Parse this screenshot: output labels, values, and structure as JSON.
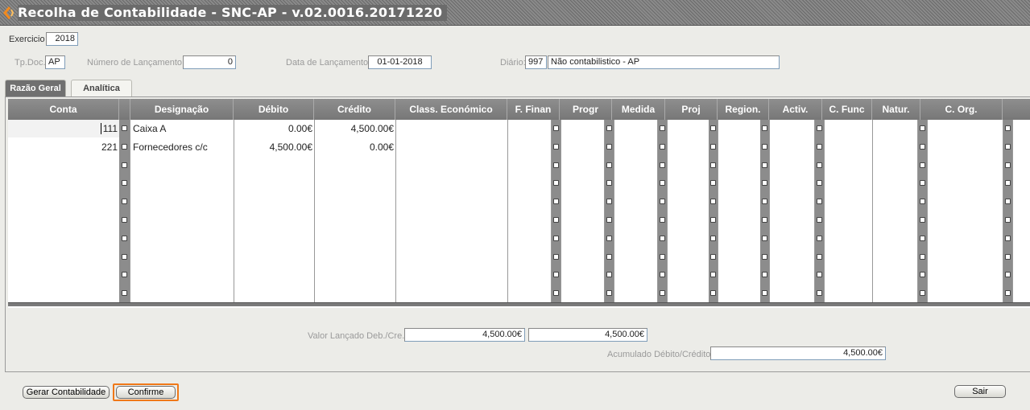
{
  "window": {
    "title": "Recolha de Contabilidade - SNC-AP - v.02.0016.20171220"
  },
  "header": {
    "exercicio_label": "Exercicio",
    "exercicio_value": "2018",
    "tpdoc_label": "Tp.Doc.",
    "tpdoc_value": "AP",
    "numero_label": "Número de Lançamento:",
    "numero_value": "0",
    "data_label": "Data de Lançamento:",
    "data_value": "01-01-2018",
    "diario_label": "Diário:",
    "diario_code": "997",
    "diario_desc": "Não contabilistico - AP"
  },
  "tabs": [
    {
      "label": "Razão Geral",
      "active": true
    },
    {
      "label": "Analítica",
      "active": false
    }
  ],
  "grid": {
    "columns": [
      "Conta",
      "Designação",
      "Débito",
      "Crédito",
      "Class. Económico",
      "F. Finan",
      "Progr",
      "Medida",
      "Proj",
      "Region.",
      "Activ.",
      "C. Func",
      "Natur.",
      "C. Org."
    ],
    "rows": [
      {
        "conta": "111",
        "designacao": "Caixa A",
        "debito": "0.00€",
        "credito": "4,500.00€"
      },
      {
        "conta": "221",
        "designacao": "Fornecedores c/c",
        "debito": "4,500.00€",
        "credito": "0.00€"
      }
    ]
  },
  "totals": {
    "valor_label": "Valor Lançado Deb./Cre.",
    "valor_deb": "4,500.00€",
    "valor_cre": "4,500.00€",
    "acumulado_label": "Acumulado Débito/Crédito:",
    "acumulado_value": "4,500.00€"
  },
  "buttons": {
    "gerar": "Gerar Contabilidade",
    "confirme": "Confirme",
    "sair": "Sair"
  },
  "colors": {
    "accent_focus": "#f07818",
    "title_bg": "#6b6b6b",
    "header_bg": "#808080"
  }
}
